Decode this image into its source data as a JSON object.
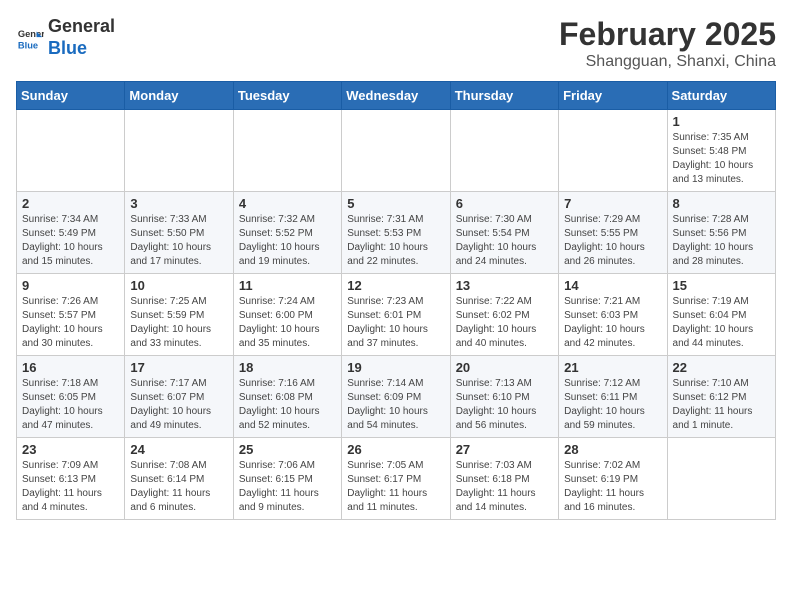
{
  "header": {
    "logo_line1": "General",
    "logo_line2": "Blue",
    "month_title": "February 2025",
    "location": "Shangguan, Shanxi, China"
  },
  "weekdays": [
    "Sunday",
    "Monday",
    "Tuesday",
    "Wednesday",
    "Thursday",
    "Friday",
    "Saturday"
  ],
  "weeks": [
    [
      {
        "day": "",
        "info": ""
      },
      {
        "day": "",
        "info": ""
      },
      {
        "day": "",
        "info": ""
      },
      {
        "day": "",
        "info": ""
      },
      {
        "day": "",
        "info": ""
      },
      {
        "day": "",
        "info": ""
      },
      {
        "day": "1",
        "info": "Sunrise: 7:35 AM\nSunset: 5:48 PM\nDaylight: 10 hours and 13 minutes."
      }
    ],
    [
      {
        "day": "2",
        "info": "Sunrise: 7:34 AM\nSunset: 5:49 PM\nDaylight: 10 hours and 15 minutes."
      },
      {
        "day": "3",
        "info": "Sunrise: 7:33 AM\nSunset: 5:50 PM\nDaylight: 10 hours and 17 minutes."
      },
      {
        "day": "4",
        "info": "Sunrise: 7:32 AM\nSunset: 5:52 PM\nDaylight: 10 hours and 19 minutes."
      },
      {
        "day": "5",
        "info": "Sunrise: 7:31 AM\nSunset: 5:53 PM\nDaylight: 10 hours and 22 minutes."
      },
      {
        "day": "6",
        "info": "Sunrise: 7:30 AM\nSunset: 5:54 PM\nDaylight: 10 hours and 24 minutes."
      },
      {
        "day": "7",
        "info": "Sunrise: 7:29 AM\nSunset: 5:55 PM\nDaylight: 10 hours and 26 minutes."
      },
      {
        "day": "8",
        "info": "Sunrise: 7:28 AM\nSunset: 5:56 PM\nDaylight: 10 hours and 28 minutes."
      }
    ],
    [
      {
        "day": "9",
        "info": "Sunrise: 7:26 AM\nSunset: 5:57 PM\nDaylight: 10 hours and 30 minutes."
      },
      {
        "day": "10",
        "info": "Sunrise: 7:25 AM\nSunset: 5:59 PM\nDaylight: 10 hours and 33 minutes."
      },
      {
        "day": "11",
        "info": "Sunrise: 7:24 AM\nSunset: 6:00 PM\nDaylight: 10 hours and 35 minutes."
      },
      {
        "day": "12",
        "info": "Sunrise: 7:23 AM\nSunset: 6:01 PM\nDaylight: 10 hours and 37 minutes."
      },
      {
        "day": "13",
        "info": "Sunrise: 7:22 AM\nSunset: 6:02 PM\nDaylight: 10 hours and 40 minutes."
      },
      {
        "day": "14",
        "info": "Sunrise: 7:21 AM\nSunset: 6:03 PM\nDaylight: 10 hours and 42 minutes."
      },
      {
        "day": "15",
        "info": "Sunrise: 7:19 AM\nSunset: 6:04 PM\nDaylight: 10 hours and 44 minutes."
      }
    ],
    [
      {
        "day": "16",
        "info": "Sunrise: 7:18 AM\nSunset: 6:05 PM\nDaylight: 10 hours and 47 minutes."
      },
      {
        "day": "17",
        "info": "Sunrise: 7:17 AM\nSunset: 6:07 PM\nDaylight: 10 hours and 49 minutes."
      },
      {
        "day": "18",
        "info": "Sunrise: 7:16 AM\nSunset: 6:08 PM\nDaylight: 10 hours and 52 minutes."
      },
      {
        "day": "19",
        "info": "Sunrise: 7:14 AM\nSunset: 6:09 PM\nDaylight: 10 hours and 54 minutes."
      },
      {
        "day": "20",
        "info": "Sunrise: 7:13 AM\nSunset: 6:10 PM\nDaylight: 10 hours and 56 minutes."
      },
      {
        "day": "21",
        "info": "Sunrise: 7:12 AM\nSunset: 6:11 PM\nDaylight: 10 hours and 59 minutes."
      },
      {
        "day": "22",
        "info": "Sunrise: 7:10 AM\nSunset: 6:12 PM\nDaylight: 11 hours and 1 minute."
      }
    ],
    [
      {
        "day": "23",
        "info": "Sunrise: 7:09 AM\nSunset: 6:13 PM\nDaylight: 11 hours and 4 minutes."
      },
      {
        "day": "24",
        "info": "Sunrise: 7:08 AM\nSunset: 6:14 PM\nDaylight: 11 hours and 6 minutes."
      },
      {
        "day": "25",
        "info": "Sunrise: 7:06 AM\nSunset: 6:15 PM\nDaylight: 11 hours and 9 minutes."
      },
      {
        "day": "26",
        "info": "Sunrise: 7:05 AM\nSunset: 6:17 PM\nDaylight: 11 hours and 11 minutes."
      },
      {
        "day": "27",
        "info": "Sunrise: 7:03 AM\nSunset: 6:18 PM\nDaylight: 11 hours and 14 minutes."
      },
      {
        "day": "28",
        "info": "Sunrise: 7:02 AM\nSunset: 6:19 PM\nDaylight: 11 hours and 16 minutes."
      },
      {
        "day": "",
        "info": ""
      }
    ]
  ]
}
